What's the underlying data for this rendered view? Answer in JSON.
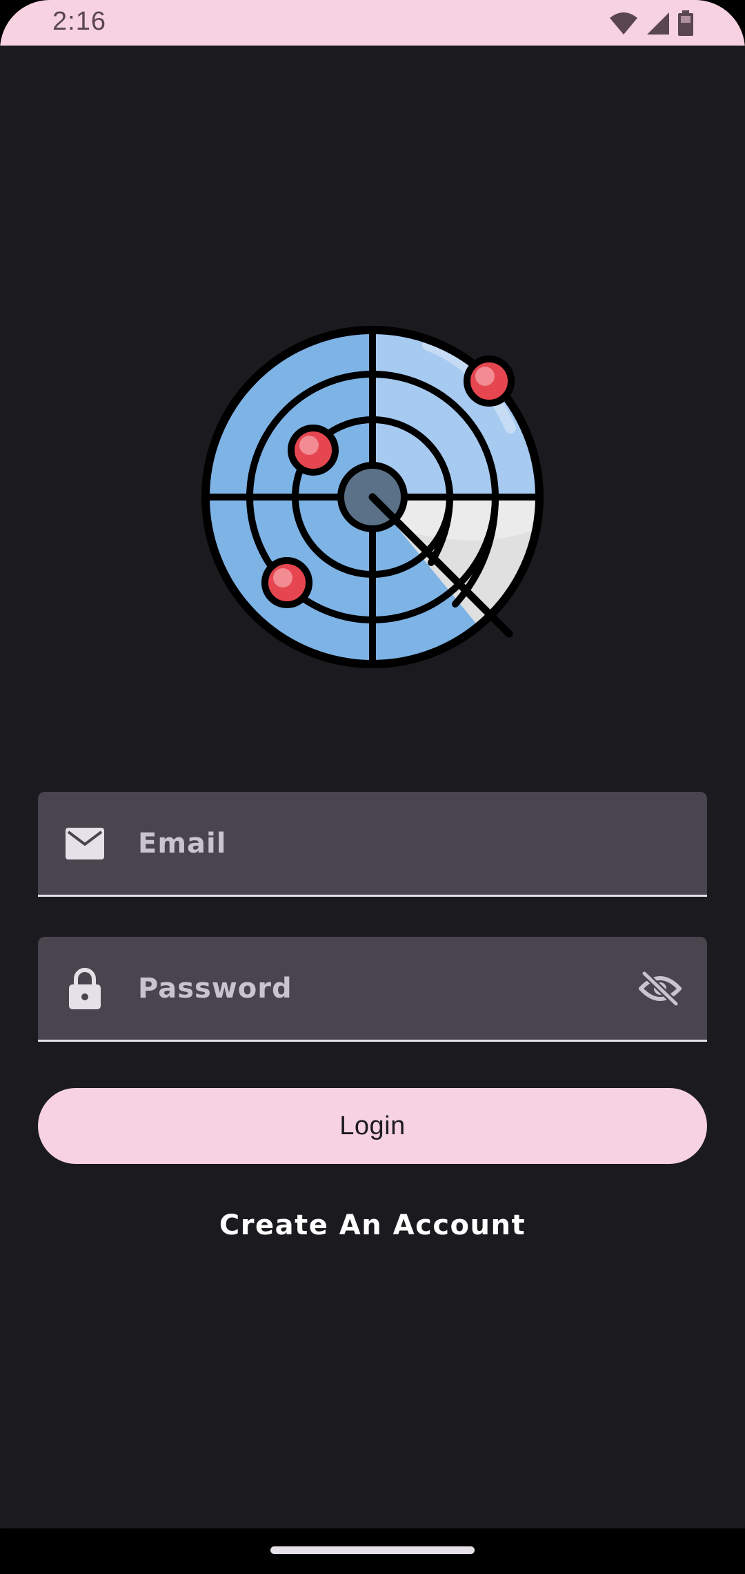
{
  "status_bar": {
    "time": "2:16",
    "icons": [
      "wifi-icon",
      "cellular-signal-icon",
      "battery-icon"
    ],
    "background": "#f7d2e0"
  },
  "logo": {
    "icon": "radar-icon"
  },
  "email_field": {
    "label": "Email",
    "icon": "mail-icon"
  },
  "password_field": {
    "label": "Password",
    "icon": "lock-icon",
    "trailing_icon": "visibility-off-icon"
  },
  "login_button": {
    "label": "Login",
    "color": "#f7d2e0"
  },
  "create_account": {
    "label": "Create An Account"
  },
  "theme": {
    "background": "#1b1b1f",
    "field_background": "#49454f",
    "field_text": "#cac4d0"
  }
}
